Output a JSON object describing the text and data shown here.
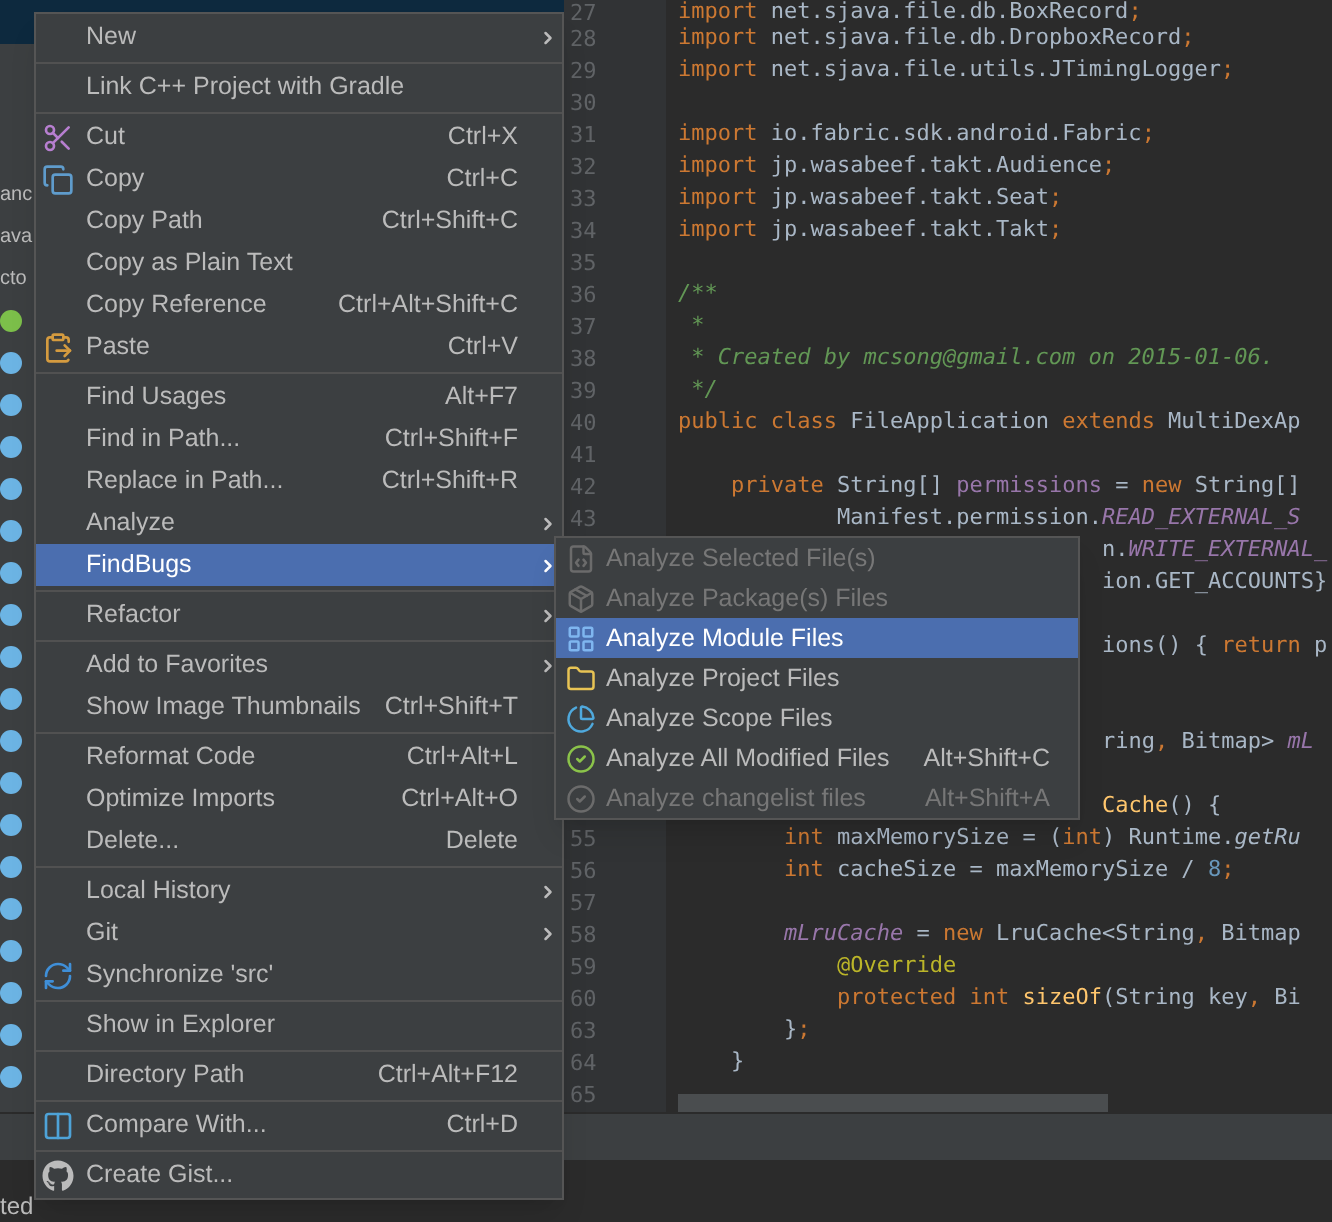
{
  "project_tree": {
    "items": [
      {
        "kind": "text",
        "label": "anc"
      },
      {
        "kind": "text",
        "label": "ava"
      },
      {
        "kind": "text",
        "label": "cto"
      },
      {
        "kind": "interface"
      },
      {
        "kind": "class"
      },
      {
        "kind": "class"
      },
      {
        "kind": "class"
      },
      {
        "kind": "class"
      },
      {
        "kind": "class"
      },
      {
        "kind": "class"
      },
      {
        "kind": "class"
      },
      {
        "kind": "class"
      },
      {
        "kind": "class"
      },
      {
        "kind": "class"
      },
      {
        "kind": "class"
      },
      {
        "kind": "class"
      },
      {
        "kind": "class"
      },
      {
        "kind": "class"
      },
      {
        "kind": "class"
      },
      {
        "kind": "class"
      },
      {
        "kind": "class"
      },
      {
        "kind": "class"
      }
    ]
  },
  "editor": {
    "lines": [
      {
        "kind": "indent_0",
        "number": "27",
        "segments": [
          {
            "kind": "keyword",
            "text": "import"
          },
          {
            "kind": "plain",
            "text": " net.sjava.file.db.BoxRecord"
          },
          {
            "kind": "keyword",
            "text": ";"
          }
        ]
      },
      {
        "kind": "indent_0",
        "number": "28",
        "segments": [
          {
            "kind": "keyword",
            "text": "import"
          },
          {
            "kind": "plain",
            "text": " net.sjava.file.db.DropboxRecord"
          },
          {
            "kind": "keyword",
            "text": ";"
          }
        ]
      },
      {
        "kind": "indent_0",
        "number": "29",
        "segments": [
          {
            "kind": "keyword",
            "text": "import"
          },
          {
            "kind": "plain",
            "text": " net.sjava.file.utils.JTimingLogger"
          },
          {
            "kind": "keyword",
            "text": ";"
          }
        ]
      },
      {
        "kind": "indent_0",
        "number": "30"
      },
      {
        "kind": "indent_0",
        "number": "31",
        "segments": [
          {
            "kind": "keyword",
            "text": "import"
          },
          {
            "kind": "plain",
            "text": " io.fabric.sdk.android.Fabric"
          },
          {
            "kind": "keyword",
            "text": ";"
          }
        ]
      },
      {
        "kind": "indent_0",
        "number": "32",
        "segments": [
          {
            "kind": "keyword",
            "text": "import"
          },
          {
            "kind": "plain",
            "text": " jp.wasabeef.takt.Audience"
          },
          {
            "kind": "keyword",
            "text": ";"
          }
        ]
      },
      {
        "kind": "indent_0",
        "number": "33",
        "segments": [
          {
            "kind": "keyword",
            "text": "import"
          },
          {
            "kind": "plain",
            "text": " jp.wasabeef.takt.Seat"
          },
          {
            "kind": "keyword",
            "text": ";"
          }
        ]
      },
      {
        "kind": "indent_0",
        "number": "34",
        "segments": [
          {
            "kind": "keyword",
            "text": "import"
          },
          {
            "kind": "plain",
            "text": " jp.wasabeef.takt.Takt"
          },
          {
            "kind": "keyword",
            "text": ";"
          }
        ]
      },
      {
        "kind": "indent_0",
        "number": "35"
      },
      {
        "kind": "indent_0",
        "number": "36",
        "segments": [
          {
            "kind": "comment",
            "text": "/**"
          }
        ]
      },
      {
        "kind": "indent_0",
        "number": "37",
        "segments": [
          {
            "kind": "comment",
            "text": " *"
          }
        ]
      },
      {
        "kind": "indent_0",
        "number": "38",
        "segments": [
          {
            "kind": "comment",
            "text": " * Created by mcsong@gmail.com on 2015-01-06."
          }
        ]
      },
      {
        "kind": "indent_0",
        "number": "39",
        "segments": [
          {
            "kind": "comment",
            "text": " */"
          }
        ]
      },
      {
        "kind": "indent_0",
        "number": "40",
        "segments": [
          {
            "kind": "keyword",
            "text": "public class"
          },
          {
            "kind": "plain",
            "text": " FileApplication "
          },
          {
            "kind": "keyword",
            "text": "extends"
          },
          {
            "kind": "plain",
            "text": " MultiDexAp"
          }
        ]
      },
      {
        "kind": "indent_0",
        "number": "41"
      },
      {
        "kind": "indent_1",
        "number": "42",
        "segments": [
          {
            "kind": "keyword",
            "text": "private"
          },
          {
            "kind": "plain",
            "text": " String[] "
          },
          {
            "kind": "field",
            "text": "permissions"
          },
          {
            "kind": "plain",
            "text": " = "
          },
          {
            "kind": "keyword",
            "text": "new"
          },
          {
            "kind": "plain",
            "text": " String[]"
          }
        ]
      },
      {
        "kind": "indent_3",
        "number": "43",
        "segments": [
          {
            "kind": "plain",
            "text": "Manifest.permission."
          },
          {
            "kind": "static_field",
            "text": "READ_EXTERNAL_S"
          }
        ]
      },
      {
        "kind": "indent_8",
        "segments": [
          {
            "kind": "plain",
            "text": "n."
          },
          {
            "kind": "static_field",
            "text": "WRITE_EXTERNAL_"
          }
        ]
      },
      {
        "kind": "indent_8",
        "segments": [
          {
            "kind": "plain",
            "text": "ion.GET_ACCOUNTS}"
          }
        ]
      },
      {
        "kind": "blank"
      },
      {
        "kind": "indent_8",
        "segments": [
          {
            "kind": "plain",
            "text": "ions() { "
          },
          {
            "kind": "keyword",
            "text": "return"
          },
          {
            "kind": "plain",
            "text": " p"
          }
        ]
      },
      {
        "kind": "blank"
      },
      {
        "kind": "blank"
      },
      {
        "kind": "indent_8",
        "segments": [
          {
            "kind": "plain",
            "text": "ring"
          },
          {
            "kind": "keyword",
            "text": ","
          },
          {
            "kind": "plain",
            "text": " Bitmap> "
          },
          {
            "kind": "static_field",
            "text": "mL"
          }
        ]
      },
      {
        "kind": "blank"
      },
      {
        "kind": "indent_8",
        "segments": [
          {
            "kind": "method",
            "text": "Cache"
          },
          {
            "kind": "plain",
            "text": "() {"
          }
        ]
      },
      {
        "kind": "indent_2",
        "number": "55",
        "segments": [
          {
            "kind": "keyword",
            "text": "int"
          },
          {
            "kind": "plain",
            "text": " maxMemorySize = ("
          },
          {
            "kind": "keyword",
            "text": "int"
          },
          {
            "kind": "plain",
            "text": ") Runtime."
          },
          {
            "kind": "static_call",
            "text": "getRu"
          }
        ]
      },
      {
        "kind": "indent_2",
        "number": "56",
        "segments": [
          {
            "kind": "keyword",
            "text": "int"
          },
          {
            "kind": "plain",
            "text": " cacheSize = maxMemorySize / "
          },
          {
            "kind": "number",
            "text": "8"
          },
          {
            "kind": "keyword",
            "text": ";"
          }
        ]
      },
      {
        "kind": "indent_0",
        "number": "57"
      },
      {
        "kind": "indent_2",
        "number": "58",
        "segments": [
          {
            "kind": "static_field",
            "text": "mLruCache"
          },
          {
            "kind": "plain",
            "text": " = "
          },
          {
            "kind": "keyword",
            "text": "new"
          },
          {
            "kind": "plain",
            "text": " LruCache<String"
          },
          {
            "kind": "keyword",
            "text": ","
          },
          {
            "kind": "plain",
            "text": " Bitmap"
          }
        ]
      },
      {
        "kind": "indent_3",
        "number": "59",
        "segments": [
          {
            "kind": "annotation",
            "text": "@Override"
          }
        ]
      },
      {
        "kind": "indent_3",
        "number": "60",
        "segments": [
          {
            "kind": "keyword",
            "text": "protected int "
          },
          {
            "kind": "method",
            "text": "sizeOf"
          },
          {
            "kind": "plain",
            "text": "(String key"
          },
          {
            "kind": "keyword",
            "text": ","
          },
          {
            "kind": "plain",
            "text": " Bi"
          }
        ]
      },
      {
        "kind": "indent_2",
        "number": "63",
        "segments": [
          {
            "kind": "plain",
            "text": "}"
          },
          {
            "kind": "keyword",
            "text": ";"
          }
        ]
      },
      {
        "kind": "indent_1",
        "number": "64",
        "segments": [
          {
            "kind": "plain",
            "text": "}"
          }
        ]
      },
      {
        "kind": "indent_0",
        "number": "65"
      }
    ]
  },
  "context_menu": {
    "items": [
      {
        "kind": "item",
        "label": "New",
        "submenu": true,
        "selected": false
      },
      {
        "kind": "separator"
      },
      {
        "kind": "item",
        "label": "Link C++ Project with Gradle",
        "submenu": false,
        "selected": false
      },
      {
        "kind": "separator"
      },
      {
        "kind": "item",
        "label": "Cut",
        "shortcut": "Ctrl+X",
        "submenu": false,
        "selected": false
      },
      {
        "kind": "item",
        "label": "Copy",
        "shortcut": "Ctrl+C",
        "submenu": false,
        "selected": false
      },
      {
        "kind": "item",
        "label": "Copy Path",
        "shortcut": "Ctrl+Shift+C",
        "submenu": false,
        "selected": false
      },
      {
        "kind": "item",
        "label": "Copy as Plain Text",
        "submenu": false,
        "selected": false
      },
      {
        "kind": "item",
        "label": "Copy Reference",
        "shortcut": "Ctrl+Alt+Shift+C",
        "submenu": false,
        "selected": false
      },
      {
        "kind": "item",
        "label": "Paste",
        "shortcut": "Ctrl+V",
        "submenu": false,
        "selected": false
      },
      {
        "kind": "separator"
      },
      {
        "kind": "item",
        "label": "Find Usages",
        "shortcut": "Alt+F7",
        "submenu": false,
        "selected": false
      },
      {
        "kind": "item",
        "label": "Find in Path...",
        "shortcut": "Ctrl+Shift+F",
        "submenu": false,
        "selected": false
      },
      {
        "kind": "item",
        "label": "Replace in Path...",
        "shortcut": "Ctrl+Shift+R",
        "submenu": false,
        "selected": false
      },
      {
        "kind": "item",
        "label": "Analyze",
        "submenu": true,
        "selected": false
      },
      {
        "kind": "item",
        "label": "FindBugs",
        "submenu": true,
        "selected": true
      },
      {
        "kind": "separator"
      },
      {
        "kind": "item",
        "label": "Refactor",
        "submenu": true,
        "selected": false
      },
      {
        "kind": "separator"
      },
      {
        "kind": "item",
        "label": "Add to Favorites",
        "submenu": true,
        "selected": false
      },
      {
        "kind": "item",
        "label": "Show Image Thumbnails",
        "shortcut": "Ctrl+Shift+T",
        "submenu": false,
        "selected": false
      },
      {
        "kind": "separator"
      },
      {
        "kind": "item",
        "label": "Reformat Code",
        "shortcut": "Ctrl+Alt+L",
        "submenu": false,
        "selected": false
      },
      {
        "kind": "item",
        "label": "Optimize Imports",
        "shortcut": "Ctrl+Alt+O",
        "submenu": false,
        "selected": false
      },
      {
        "kind": "item",
        "label": "Delete...",
        "shortcut": "Delete",
        "submenu": false,
        "selected": false
      },
      {
        "kind": "separator"
      },
      {
        "kind": "item",
        "label": "Local History",
        "submenu": true,
        "selected": false
      },
      {
        "kind": "item",
        "label": "Git",
        "submenu": true,
        "selected": false
      },
      {
        "kind": "item",
        "label": "Synchronize 'src'",
        "submenu": false,
        "selected": false
      },
      {
        "kind": "separator"
      },
      {
        "kind": "item",
        "label": "Show in Explorer",
        "submenu": false,
        "selected": false
      },
      {
        "kind": "separator"
      },
      {
        "kind": "item",
        "label": "Directory Path",
        "shortcut": "Ctrl+Alt+F12",
        "submenu": false,
        "selected": false
      },
      {
        "kind": "separator"
      },
      {
        "kind": "item",
        "label": "Compare With...",
        "shortcut": "Ctrl+D",
        "submenu": false,
        "selected": false
      },
      {
        "kind": "separator"
      },
      {
        "kind": "item",
        "label": "Create Gist...",
        "submenu": false,
        "selected": false
      }
    ]
  },
  "findbugs_submenu": {
    "items": [
      {
        "label": "Analyze Selected File(s)",
        "disabled": true,
        "selected": false
      },
      {
        "label": "Analyze Package(s) Files",
        "disabled": true,
        "selected": false
      },
      {
        "label": "Analyze Module Files",
        "disabled": false,
        "selected": true
      },
      {
        "label": "Analyze Project Files",
        "disabled": false,
        "selected": false
      },
      {
        "label": "Analyze Scope Files",
        "disabled": false,
        "selected": false
      },
      {
        "label": "Analyze All Modified Files",
        "shortcut": "Alt+Shift+C",
        "disabled": false,
        "selected": false
      },
      {
        "label": "Analyze changelist files",
        "shortcut": "Alt+Shift+A",
        "disabled": true,
        "selected": false
      }
    ]
  },
  "status_bar": {
    "text": "ted"
  }
}
